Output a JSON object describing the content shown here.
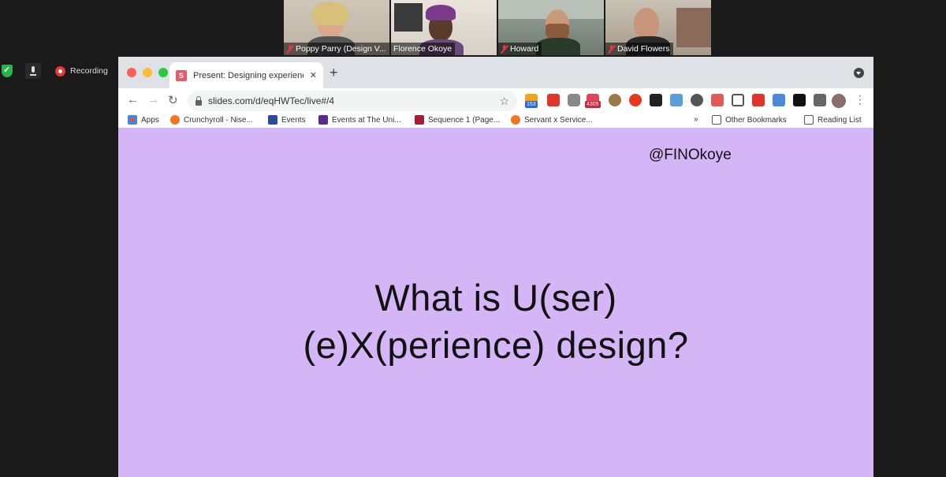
{
  "zoom": {
    "participants": [
      {
        "name": "Poppy Parry (Design V...",
        "muted": true
      },
      {
        "name": "Florence Okoye",
        "muted": false
      },
      {
        "name": "Howard",
        "muted": true
      },
      {
        "name": "David Flowers",
        "muted": true
      }
    ],
    "recording_label": "Recording"
  },
  "browser": {
    "tab_title": "Present: Designing experience",
    "tab_favicon": "S",
    "url": "slides.com/d/eqHWTec/live#/4",
    "extension_badges": {
      "feed": "153",
      "mail": "4305"
    },
    "bookmarks": [
      {
        "label": "Apps",
        "icon": "apps-grid-icon"
      },
      {
        "label": "Crunchyroll - Nise...",
        "icon": "crunchyroll-icon"
      },
      {
        "label": "Events",
        "icon": "events-icon"
      },
      {
        "label": "Events at The Uni...",
        "icon": "university-m-icon"
      },
      {
        "label": "Sequence 1 (Page...",
        "icon": "shield-crest-icon"
      },
      {
        "label": "Servant x Service...",
        "icon": "crunchyroll-icon"
      }
    ],
    "bookmarks_overflow": "»",
    "other_bookmarks": "Other Bookmarks",
    "reading_list": "Reading List"
  },
  "slide": {
    "handle": "@FINOkoye",
    "headline_line1": "What is U(ser)",
    "headline_line2": "(e)X(perience) design?"
  }
}
